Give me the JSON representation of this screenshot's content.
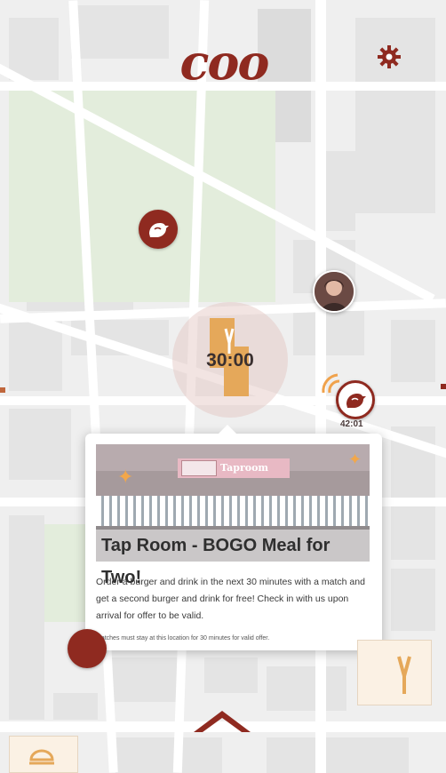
{
  "app": {
    "logo_text": "coo",
    "settings_icon": "gear-icon"
  },
  "map": {
    "markers": [
      {
        "icon": "bird-icon",
        "style": "dark"
      },
      {
        "icon": "bird-icon",
        "style": "light",
        "timer": "42:01"
      },
      {
        "icon": "user-avatar",
        "style": "photo"
      }
    ],
    "deal_zone": {
      "timer": "30:00",
      "icon": "deal-tag-icon"
    }
  },
  "popup": {
    "title": "Tap Room - BOGO Meal for Two!",
    "photo_sign_text": "Taproom",
    "description": "Order a burger and drink in the next 30 minutes with a match and get a second burger and drink for free! Check in with us upon arrival for offer to be valid.",
    "note": "Matches must stay at this location for 30 minutes for valid offer."
  },
  "colors": {
    "brand": "#8f2a20",
    "accent_orange": "#e5a85a",
    "park": "#e3eddc"
  }
}
